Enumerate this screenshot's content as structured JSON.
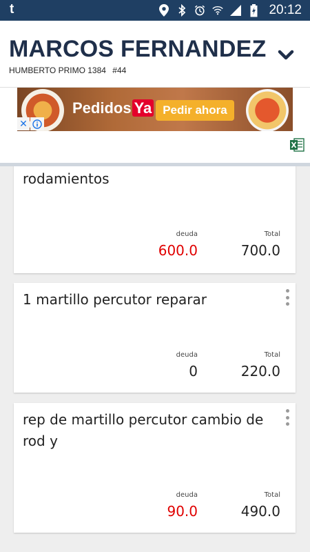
{
  "status_bar": {
    "app_icon": "t",
    "time": "20:12",
    "icons": [
      "location-icon",
      "bluetooth-icon",
      "alarm-icon",
      "wifi-icon",
      "signal-icon",
      "battery-charging-icon"
    ]
  },
  "header": {
    "title": "MARCOS FERNANDEZ",
    "address": "HUMBERTO PRIMO 1384",
    "number": "#44"
  },
  "ad": {
    "brand_main": "Pedidos",
    "brand_ya": "Ya",
    "cta": "Pedir ahora",
    "close": "✕",
    "info_icon": "info-icon"
  },
  "colors": {
    "status_bar": "#1f3f63",
    "title": "#1f2f4a",
    "debt_red": "#e00000",
    "excel_green": "#1e7145"
  },
  "cards": [
    {
      "description": "rodamientos",
      "debt_label": "deuda",
      "debt": "600.0",
      "total_label": "Total",
      "total": "700.0",
      "debt_red": true
    },
    {
      "description": "1 martillo percutor reparar",
      "debt_label": "deuda",
      "debt": "0",
      "total_label": "Total",
      "total": "220.0",
      "debt_red": false
    },
    {
      "description": "rep de martillo percutor cambio de rod y",
      "debt_label": "deuda",
      "debt": "90.0",
      "total_label": "Total",
      "total": "490.0",
      "debt_red": true
    }
  ]
}
